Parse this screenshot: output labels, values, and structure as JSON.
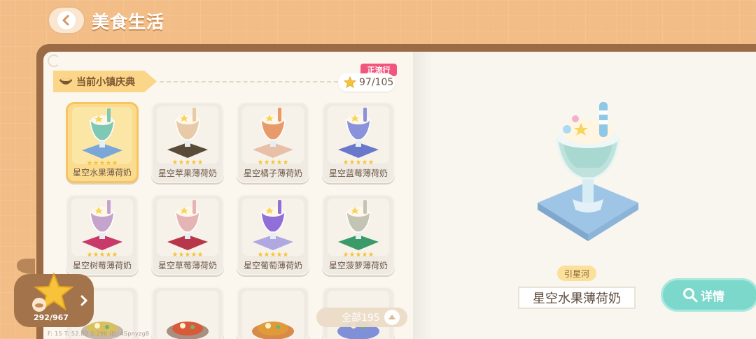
{
  "header": {
    "title": "美食生活",
    "back_icon": "chevron-left-icon"
  },
  "catalog": {
    "festival_label": "当前小镇庆典",
    "trend_badge": "正流行",
    "progress": "97/105",
    "items": [
      {
        "name": "星空水果薄荷奶",
        "accent": "#7fc9b4",
        "plate": "#7aa6d8",
        "stars": 5,
        "selected": true
      },
      {
        "name": "星空苹果薄荷奶",
        "accent": "#e8c9a8",
        "plate": "#5a4a38",
        "stars": 5,
        "selected": false
      },
      {
        "name": "星空橘子薄荷奶",
        "accent": "#e89a6a",
        "plate": "#e8c0a8",
        "stars": 5,
        "selected": false
      },
      {
        "name": "星空蓝莓薄荷奶",
        "accent": "#8a92dc",
        "plate": "#6a78cc",
        "stars": 5,
        "selected": false
      },
      {
        "name": "星空树莓薄荷奶",
        "accent": "#c4a3cc",
        "plate": "#c83a6a",
        "stars": 5,
        "selected": false
      },
      {
        "name": "星空草莓薄荷奶",
        "accent": "#e5b5b5",
        "plate": "#b8364a",
        "stars": 5,
        "selected": false
      },
      {
        "name": "星空葡萄薄荷奶",
        "accent": "#9070d8",
        "plate": "#b0a8e0",
        "stars": 5,
        "selected": false
      },
      {
        "name": "星空菠萝薄荷奶",
        "accent": "#c4c4b4",
        "plate": "#3a9a68",
        "stars": 5,
        "selected": false
      },
      {
        "name": "",
        "accent": "#d8c060",
        "plate": "#c4b8a8",
        "stars": 0,
        "selected": false
      },
      {
        "name": "",
        "accent": "#d85a3a",
        "plate": "#a89080",
        "stars": 0,
        "selected": false
      },
      {
        "name": "",
        "accent": "#e09a3a",
        "plate": "#d88a4a",
        "stars": 0,
        "selected": false
      },
      {
        "name": "",
        "accent": "#8090d8",
        "plate": "#8090d8",
        "stars": 0,
        "selected": false
      }
    ],
    "filter": {
      "label": "全部195",
      "icon": "chevron-up-icon"
    },
    "collection": {
      "count": "292/967",
      "icon": "star-icon"
    },
    "debug_text": "F: 15   T: 52.82   S:296   ID: 4Spnyzg8"
  },
  "detail": {
    "origin": "引星河",
    "name": "星空水果薄荷奶",
    "detail_button": "详情",
    "detail_icon": "search-icon"
  },
  "colors": {
    "accent_teal": "#7dd8cc",
    "selected_gold": "#fbdb8d",
    "bg_orange": "#f2bd86"
  }
}
